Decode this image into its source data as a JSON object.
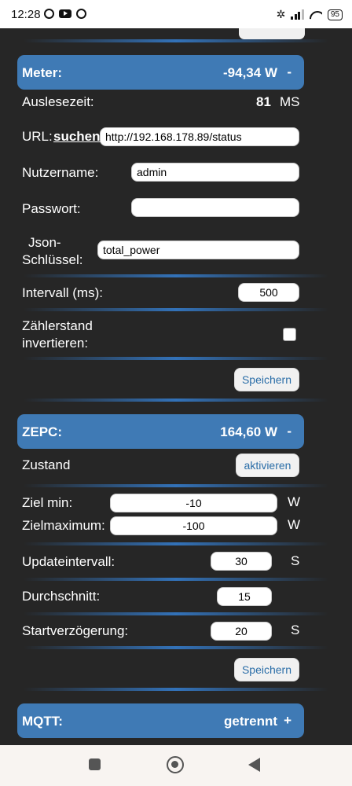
{
  "status_bar": {
    "time": "12:28",
    "battery": "95"
  },
  "meter": {
    "title": "Meter:",
    "value": "-94,34 W",
    "toggle": "-",
    "readout_label": "Auslesezeit:",
    "readout_value": "81",
    "readout_unit": "MS",
    "url_label": "URL:",
    "url_link": "suchen",
    "url_value": "http://192.168.178.89/status",
    "username_label": "Nutzername:",
    "username_value": "admin",
    "password_label": "Passwort:",
    "password_value": "",
    "json_key_label_1": "Json-",
    "json_key_label_2": "Schlüssel:",
    "json_key_value": "total_power",
    "interval_label": "Intervall (ms):",
    "interval_value": "500",
    "invert_label_1": "Zählerstand",
    "invert_label_2": "invertieren:",
    "save_label": "Speichern"
  },
  "zepc": {
    "title": "ZEPC:",
    "value": "164,60 W",
    "toggle": "-",
    "state_label": "Zustand",
    "activate_label": "aktivieren",
    "target_min_label": "Ziel min:",
    "target_min_value": "-10",
    "target_min_unit": "W",
    "target_max_label": "Zielmaximum:",
    "target_max_value": "-100",
    "target_max_unit": "W",
    "update_label": "Updateintervall:",
    "update_value": "30",
    "update_unit": "S",
    "average_label": "Durchschnitt:",
    "average_value": "15",
    "delay_label": "Startverzögerung:",
    "delay_value": "20",
    "delay_unit": "S",
    "save_label": "Speichern"
  },
  "mqtt": {
    "title": "MQTT:",
    "value": "getrennt",
    "toggle": "+"
  },
  "colors": {
    "header_bg": "#3f7ab5",
    "background": "#262626",
    "link": "#2b6ea8"
  }
}
